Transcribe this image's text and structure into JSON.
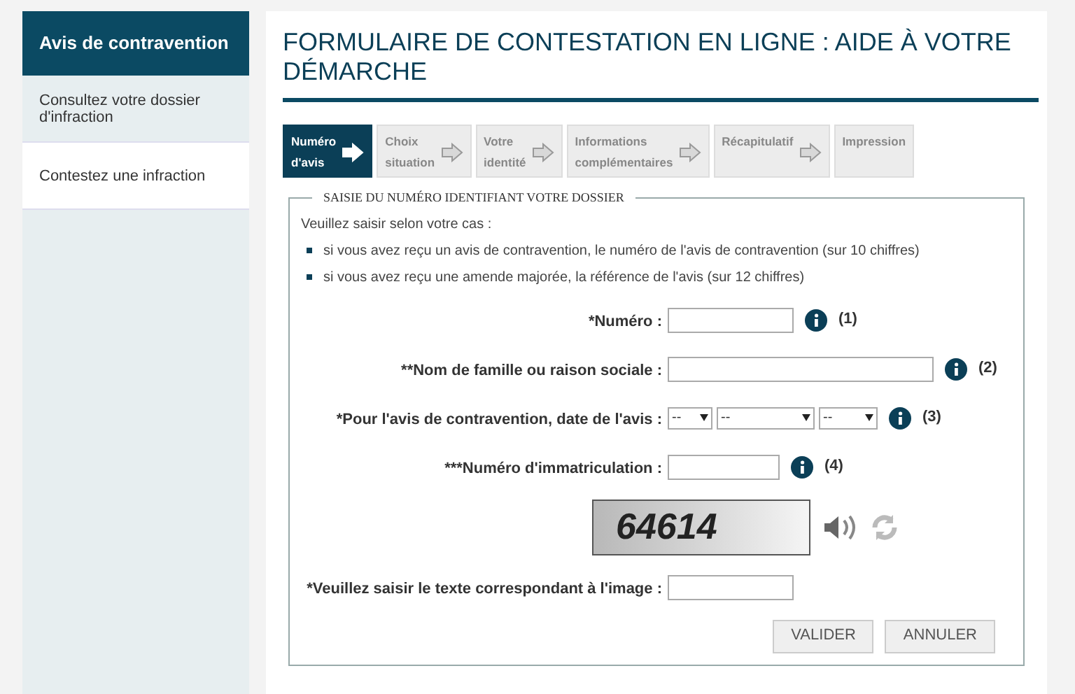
{
  "sidebar": {
    "title": "Avis de contravention",
    "items": [
      {
        "label": "Consultez votre dossier d'infraction",
        "selected": false
      },
      {
        "label": "Contestez une infraction",
        "selected": true
      }
    ]
  },
  "title": "FORMULAIRE DE CONTESTATION EN LIGNE : AIDE À VOTRE DÉMARCHE",
  "steps": [
    {
      "label": "Numéro d'avis",
      "selected": true
    },
    {
      "label": "Choix situation",
      "selected": false
    },
    {
      "label": "Votre identité",
      "selected": false
    },
    {
      "label": "Informations complémentaires",
      "selected": false
    },
    {
      "label": "Récapitulatif",
      "selected": false
    },
    {
      "label": "Impression",
      "selected": false
    }
  ],
  "fieldset": {
    "legend": "SAISIE DU NUMÉRO IDENTIFIANT VOTRE DOSSIER",
    "intro": "Veuillez saisir selon votre cas :",
    "bullets": [
      "si vous avez reçu un avis de contravention, le numéro de l'avis de contravention (sur 10 chiffres)",
      "si vous avez reçu une amende majorée, la référence de l'avis (sur 12 chiffres)"
    ]
  },
  "fields": [
    {
      "kind": "text",
      "label": "*Numéro :",
      "note": "(1)"
    },
    {
      "kind": "text",
      "label": "**Nom de famille ou raison sociale :",
      "note": "(2)"
    },
    {
      "kind": "date",
      "label": "*Pour l'avis de contravention, date de l'avis :",
      "selects": [
        "--",
        "--",
        "--"
      ],
      "note": "(3)"
    },
    {
      "kind": "text",
      "label": "***Numéro d'immatriculation :",
      "note": "(4)"
    }
  ],
  "captcha": {
    "text": "64614",
    "label": "*Veuillez saisir le texte correspondant à l'image :"
  },
  "buttons": [
    "VALIDER",
    "ANNULER"
  ]
}
